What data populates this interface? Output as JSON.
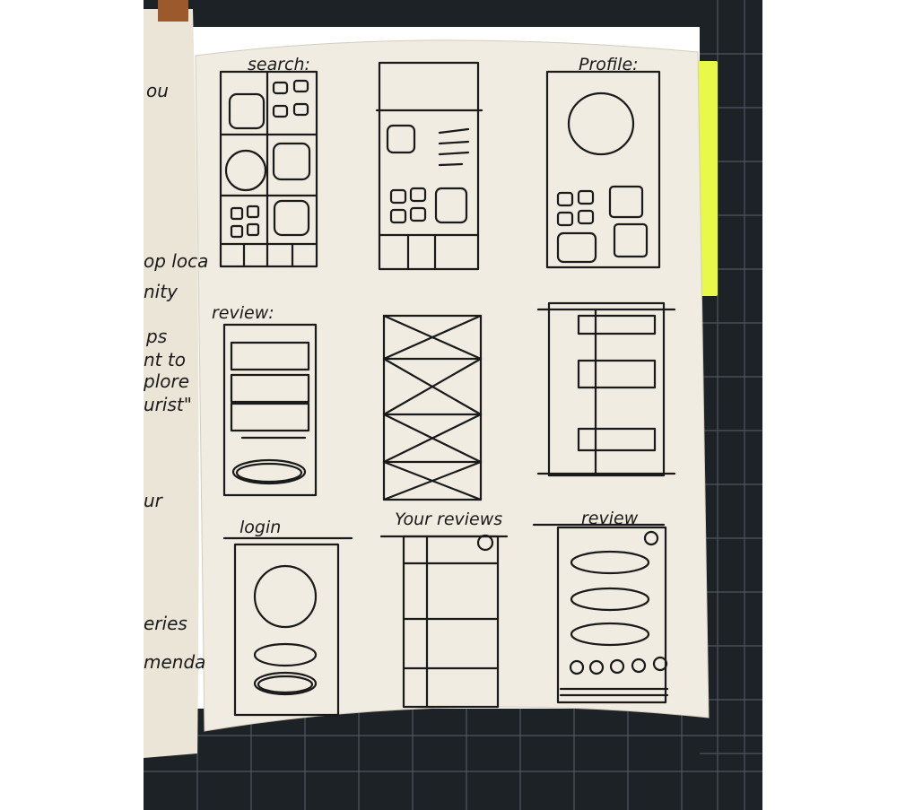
{
  "colors": {
    "mat": "#1d2226",
    "mat_grid": "#58606a",
    "paper": "#f1ece1",
    "paper_left": "#ebe5d8",
    "ink": "#1a1a1a",
    "sticky_note": "#e9f94a",
    "tape": "#9c5a2c"
  },
  "labels": {
    "search": "search:",
    "profile": "Profile:",
    "review_top": "review:",
    "login": "login",
    "your_reviews": "Your reviews",
    "review_bottom": "review"
  },
  "left_page_fragments": [
    "ou",
    "op loca",
    "nity",
    "ps",
    "nt to",
    "plore",
    "urist\"",
    "ur",
    "eries",
    "menda"
  ]
}
